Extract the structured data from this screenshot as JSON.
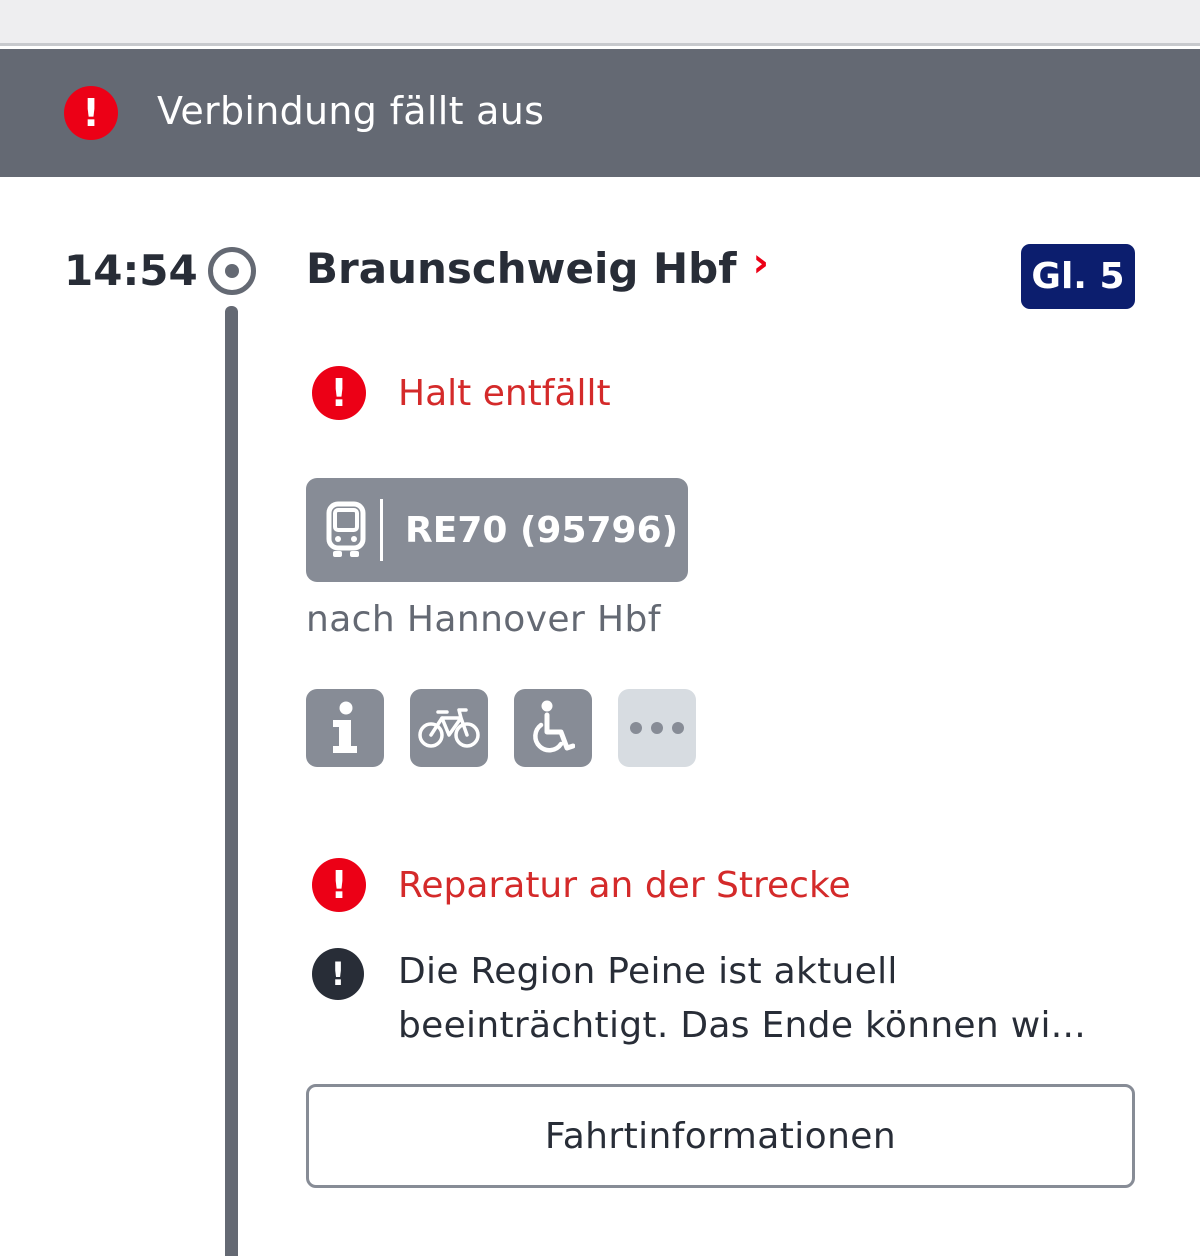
{
  "banner": {
    "text": "Verbindung fällt aus",
    "icon": "alert-icon",
    "background": "#646973"
  },
  "stop": {
    "time": "14:54",
    "station": "Braunschweig Hbf",
    "station_chevron": "›",
    "platform": "Gl. 5",
    "platform_color": "#0c1e6e"
  },
  "alerts": {
    "halt": "Halt entfällt",
    "repair": "Reparatur an der Strecke",
    "info": "Die Region Peine ist aktuell beeinträchtigt. Das Ende können wi..."
  },
  "train": {
    "icon": "train-icon",
    "name": "RE70 (95796)",
    "destination": "nach Hannover Hbf"
  },
  "attributes": [
    "info-icon",
    "bicycle-icon",
    "wheelchair-icon",
    "more-icon"
  ],
  "button": {
    "label": "Fahrtinformationen"
  },
  "colors": {
    "alert_red": "#ec0016",
    "text_dark": "#282d37",
    "grey": "#878c96"
  }
}
